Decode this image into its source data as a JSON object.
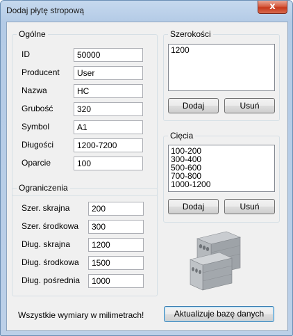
{
  "window": {
    "title": "Dodaj płytę stropową",
    "close_label": "x"
  },
  "general": {
    "title": "Ogólne",
    "fields": [
      {
        "label": "ID",
        "value": "50000"
      },
      {
        "label": "Producent",
        "value": "User"
      },
      {
        "label": "Nazwa",
        "value": "HC"
      },
      {
        "label": "Grubość",
        "value": "320"
      },
      {
        "label": "Symbol",
        "value": "A1"
      },
      {
        "label": "Długości",
        "value": "1200-7200"
      },
      {
        "label": "Oparcie",
        "value": "100"
      }
    ]
  },
  "limits": {
    "title": "Ograniczenia",
    "fields": [
      {
        "label": "Szer. skrajna",
        "value": "200"
      },
      {
        "label": "Szer. środkowa",
        "value": "300"
      },
      {
        "label": "Dług. skrajna",
        "value": "1200"
      },
      {
        "label": "Dług. środkowa",
        "value": "1500"
      },
      {
        "label": "Dług. pośrednia",
        "value": "1000"
      }
    ]
  },
  "widths": {
    "title": "Szerokości",
    "items": [
      "1200"
    ],
    "add_label": "Dodaj",
    "remove_label": "Usuń"
  },
  "cuts": {
    "title": "Cięcia",
    "items": [
      "100-200",
      "300-400",
      "500-600",
      "700-800",
      "1000-1200"
    ],
    "add_label": "Dodaj",
    "remove_label": "Usuń"
  },
  "footer": {
    "note": "Wszystkie wymiary w milimetrach!",
    "update_label": "Aktualizuje bazę danych"
  }
}
